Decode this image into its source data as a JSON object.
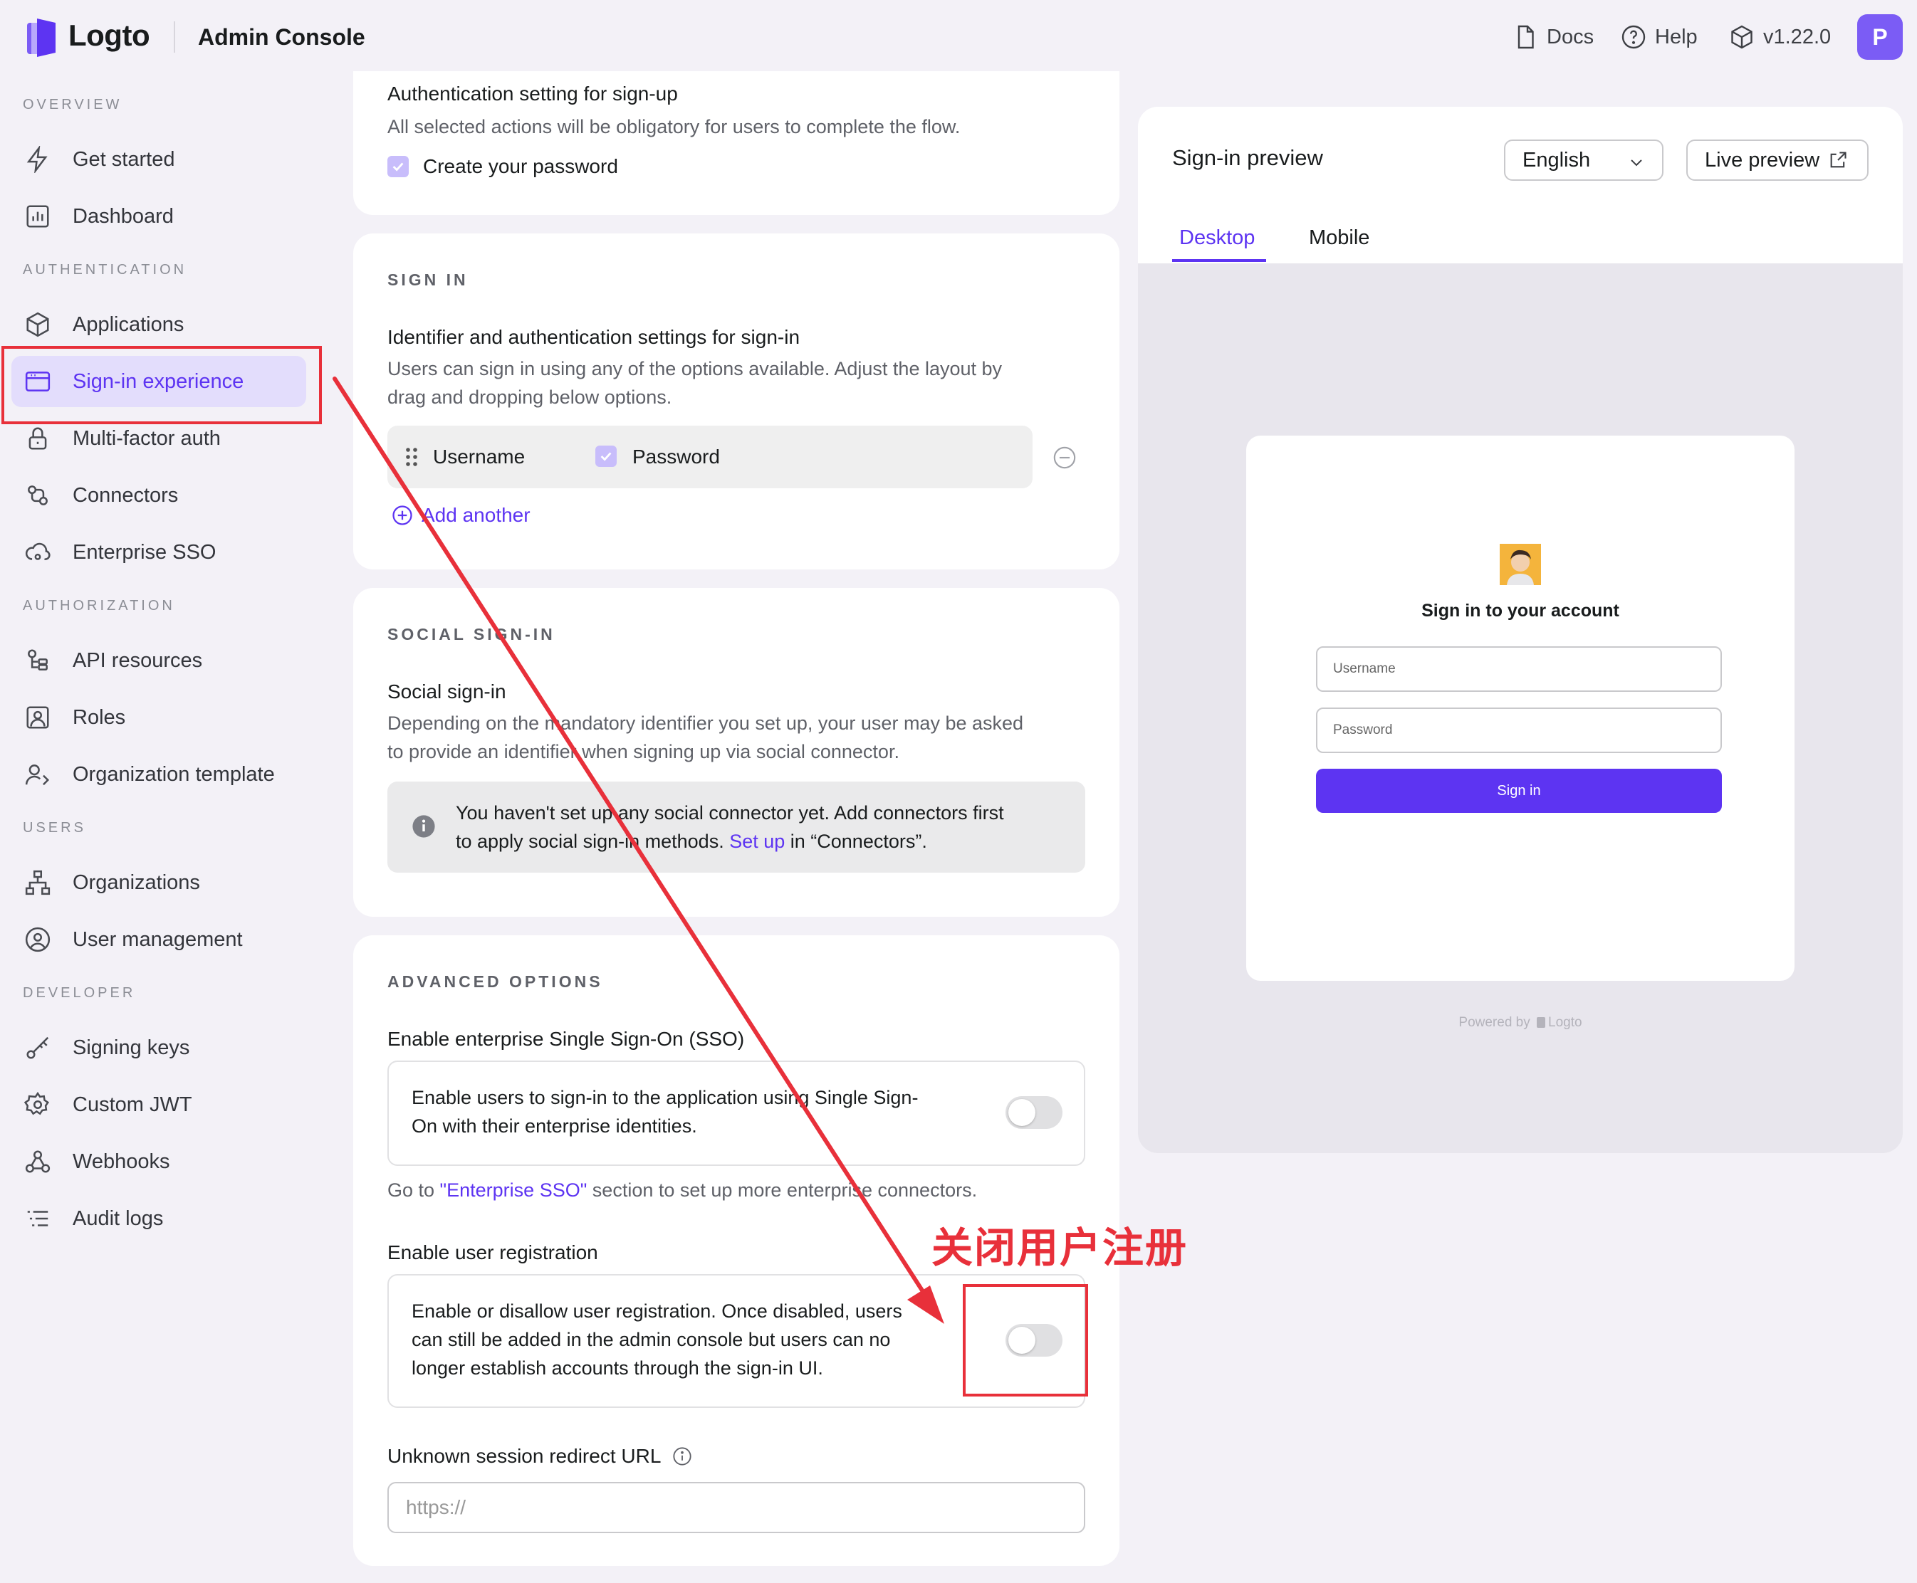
{
  "header": {
    "logo_text": "Logto",
    "title": "Admin Console",
    "docs": "Docs",
    "help": "Help",
    "version": "v1.22.0",
    "avatar_letter": "P"
  },
  "sidebar": {
    "sections": {
      "overview": "OVERVIEW",
      "authentication": "AUTHENTICATION",
      "authorization": "AUTHORIZATION",
      "users": "USERS",
      "developer": "DEVELOPER"
    },
    "items": {
      "get_started": "Get started",
      "dashboard": "Dashboard",
      "applications": "Applications",
      "sign_in_experience": "Sign-in experience",
      "mfa": "Multi-factor auth",
      "connectors": "Connectors",
      "enterprise_sso": "Enterprise SSO",
      "api_resources": "API resources",
      "roles": "Roles",
      "org_template": "Organization template",
      "organizations": "Organizations",
      "user_management": "User management",
      "signing_keys": "Signing keys",
      "custom_jwt": "Custom JWT",
      "webhooks": "Webhooks",
      "audit_logs": "Audit logs"
    }
  },
  "signup_card": {
    "title": "Authentication setting for sign-up",
    "desc": "All selected actions will be obligatory for users to complete the flow.",
    "checkbox_label": "Create your password"
  },
  "signin_card": {
    "section": "SIGN IN",
    "title": "Identifier and authentication settings for sign-in",
    "desc_line1": "Users can sign in using any of the options available. Adjust the layout by",
    "desc_line2": "drag and dropping below options.",
    "identifier": "Username",
    "auth_method": "Password",
    "add_another": "Add another"
  },
  "social_card": {
    "section": "SOCIAL SIGN-IN",
    "title": "Social sign-in",
    "desc_line1": "Depending on the mandatory identifier you set up, your user may be asked",
    "desc_line2": "to provide an identifier when signing up via social connector.",
    "notice_line1": "You haven't set up any social connector yet. Add connectors first",
    "notice_line2_a": "to apply social sign-in methods. ",
    "notice_link": "Set up",
    "notice_line2_b": " in “Connectors”."
  },
  "advanced_card": {
    "section": "ADVANCED OPTIONS",
    "sso_title": "Enable enterprise Single Sign-On (SSO)",
    "sso_desc_line1": "Enable users to sign-in to the application using Single Sign-",
    "sso_desc_line2": "On with their enterprise identities.",
    "sso_hint_a": "Go to ",
    "sso_hint_link": "\"Enterprise SSO\"",
    "sso_hint_b": " section to set up more enterprise connectors.",
    "reg_title": "Enable user registration",
    "reg_desc_line1": "Enable or disallow user registration. Once disabled, users",
    "reg_desc_line2": "can still be added in the admin console but users can no",
    "reg_desc_line3": "longer establish accounts through the sign-in UI.",
    "redirect_title": "Unknown session redirect URL",
    "redirect_placeholder": "https://"
  },
  "preview": {
    "title": "Sign-in preview",
    "language": "English",
    "live_preview": "Live preview",
    "tabs": [
      "Desktop",
      "Mobile"
    ],
    "heading": "Sign in to your account",
    "username_placeholder": "Username",
    "password_placeholder": "Password",
    "sign_in_button": "Sign in",
    "powered_by": "Powered by",
    "powered_brand": "Logto"
  },
  "annotation": {
    "text": "关闭用户注册"
  },
  "colors": {
    "accent": "#5d34f2",
    "annotation": "#e8303a"
  }
}
